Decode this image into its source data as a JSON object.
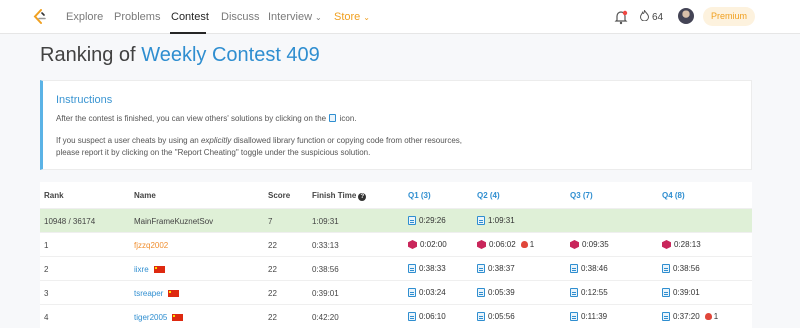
{
  "nav": {
    "items": [
      "Explore",
      "Problems",
      "Contest",
      "Discuss",
      "Interview",
      "Store"
    ],
    "streak": "64",
    "premium": "Premium"
  },
  "page": {
    "title_prefix": "Ranking of",
    "contest_name": "Weekly Contest 409"
  },
  "instructions": {
    "title": "Instructions",
    "line1_a": "After the contest is finished, you can view others' solutions by clicking on the",
    "line1_b": "icon.",
    "line2_a": "If you suspect a user cheats by using an",
    "line2_em": "explicitly",
    "line2_b": "disallowed library function or copying code from other resources,",
    "line3": "please report it by clicking on the \"Report Cheating\" toggle under the suspicious solution."
  },
  "table": {
    "headers": {
      "rank": "Rank",
      "name": "Name",
      "score": "Score",
      "finish": "Finish Time",
      "q1": "Q1 (3)",
      "q2": "Q2 (4)",
      "q3": "Q3 (7)",
      "q4": "Q4 (8)"
    },
    "rows": [
      {
        "rank": "10948 / 36174",
        "name": "MainFrameKuznetSov",
        "score": "7",
        "finish": "1:09:31",
        "q1": "0:29:26",
        "q2": "1:09:31",
        "q3": "",
        "q4": ""
      },
      {
        "rank": "1",
        "name": "fjzzq2002",
        "score": "22",
        "finish": "0:33:13",
        "q1": "0:02:00",
        "q2": "0:06:02",
        "q2_bugs": "1",
        "q3": "0:09:35",
        "q4": "0:28:13"
      },
      {
        "rank": "2",
        "name": "iixre",
        "score": "22",
        "finish": "0:38:56",
        "q1": "0:38:33",
        "q2": "0:38:37",
        "q3": "0:38:46",
        "q4": "0:38:56"
      },
      {
        "rank": "3",
        "name": "tsreaper",
        "score": "22",
        "finish": "0:39:01",
        "q1": "0:03:24",
        "q2": "0:05:39",
        "q3": "0:12:55",
        "q4": "0:39:01"
      },
      {
        "rank": "4",
        "name": "tiger2005",
        "score": "22",
        "finish": "0:42:20",
        "q1": "0:06:10",
        "q2": "0:05:56",
        "q3": "0:11:39",
        "q4": "0:37:20",
        "q4_bugs": "1"
      }
    ]
  }
}
